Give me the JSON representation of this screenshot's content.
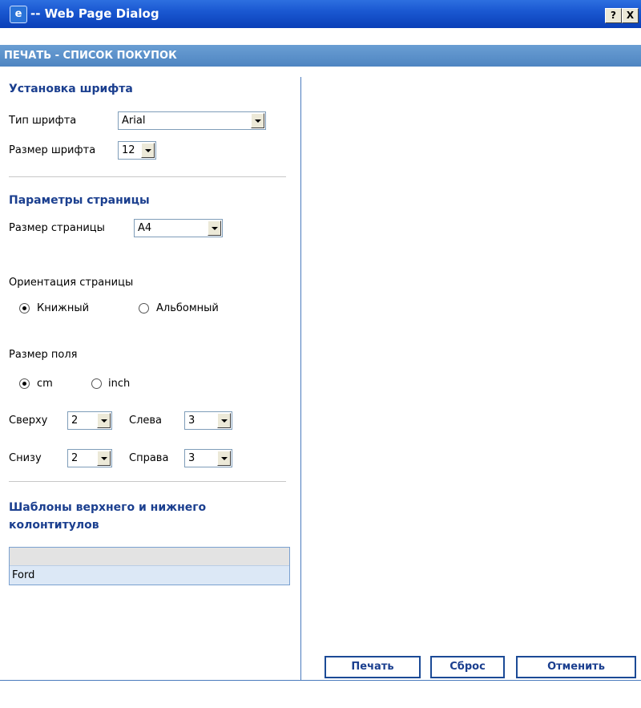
{
  "window": {
    "title": "-- Web Page Dialog",
    "help_button": "?",
    "close_button": "X",
    "icon": "ie-icon"
  },
  "header": {
    "title": "ПЕЧАТЬ - СПИСОК ПОКУПОК"
  },
  "font_settings": {
    "section_title": "Установка шрифта",
    "font_type_label": "Тип шрифта",
    "font_type_value": "Arial",
    "font_size_label": "Размер шрифта",
    "font_size_value": "12"
  },
  "page_settings": {
    "section_title": "Параметры страницы",
    "page_size_label": "Размер страницы",
    "page_size_value": "A4",
    "orientation_label": "Ориентация страницы",
    "orientation_options": [
      {
        "label": "Книжный",
        "selected": true
      },
      {
        "label": "Альбомный",
        "selected": false
      }
    ],
    "margin_label": "Размер поля",
    "margin_units": [
      {
        "label": "cm",
        "selected": true
      },
      {
        "label": "inch",
        "selected": false
      }
    ],
    "top_label": "Сверху",
    "top_value": "2",
    "left_label": "Слева",
    "left_value": "3",
    "bottom_label": "Снизу",
    "bottom_value": "2",
    "right_label": "Справа",
    "right_value": "3"
  },
  "templates": {
    "section_title_line1": "Шаблоны верхнего и нижнего",
    "section_title_line2": "колонтитулов",
    "rows": [
      "Ford"
    ]
  },
  "actions": {
    "print": "Печать",
    "reset": "Сброс",
    "cancel": "Отменить"
  }
}
